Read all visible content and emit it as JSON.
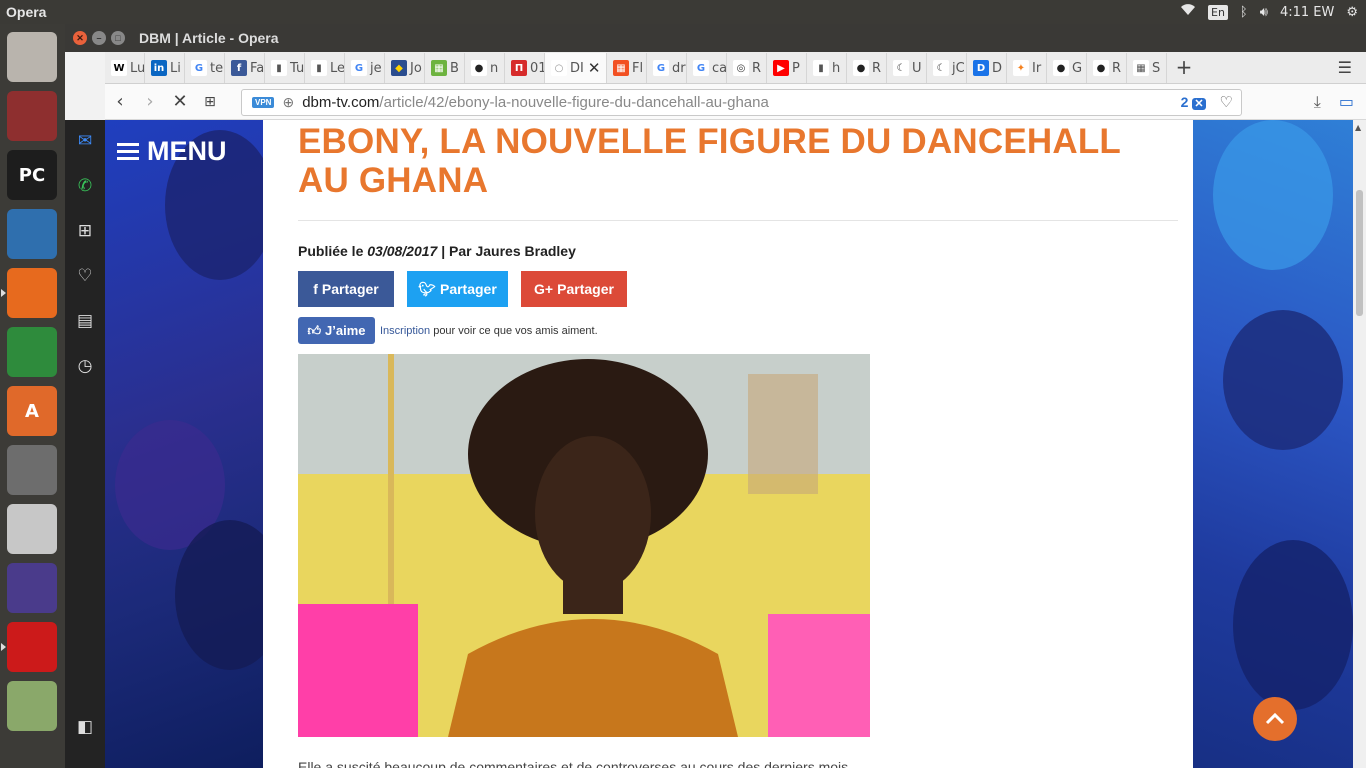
{
  "top_panel": {
    "app_name": "Opera",
    "keyboard_layout": "En",
    "clock": "4:11 EW"
  },
  "launcher": {
    "items": [
      {
        "name": "ubuntu-dash",
        "color": "#b9b4ad"
      },
      {
        "name": "files",
        "color": "#8e2f2f"
      },
      {
        "name": "pycharm",
        "color": "#1d1d1d",
        "glyph": "PC"
      },
      {
        "name": "libreoffice-writer",
        "color": "#2f6fae"
      },
      {
        "name": "firefox",
        "color": "#e76a1e"
      },
      {
        "name": "libreoffice-calc",
        "color": "#2e8b3c"
      },
      {
        "name": "software-center",
        "color": "#e0692a",
        "glyph": "A"
      },
      {
        "name": "system-settings",
        "color": "#6d6d6d"
      },
      {
        "name": "libreoffice",
        "color": "#c7c7c7"
      },
      {
        "name": "eclipse",
        "color": "#4a3b8b"
      },
      {
        "name": "opera",
        "color": "#cc1a1a"
      },
      {
        "name": "workspace-switcher",
        "color": "#8aa86a"
      }
    ]
  },
  "window": {
    "title": "DBM | Article - Opera",
    "tabs": [
      {
        "fav": "W",
        "label": "Lu",
        "color": "#ffffff",
        "fg": "#000"
      },
      {
        "fav": "in",
        "label": "Li",
        "color": "#0a66c2",
        "fg": "#fff"
      },
      {
        "fav": "G",
        "label": "te",
        "color": "#ffffff",
        "fg": "#4285f4"
      },
      {
        "fav": "f",
        "label": "Fa",
        "color": "#3b5998",
        "fg": "#fff"
      },
      {
        "fav": "▮",
        "label": "Tu",
        "color": "#ffffff",
        "fg": "#555"
      },
      {
        "fav": "▮",
        "label": "Le",
        "color": "#ffffff",
        "fg": "#555"
      },
      {
        "fav": "G",
        "label": "je",
        "color": "#ffffff",
        "fg": "#4285f4"
      },
      {
        "fav": "◆",
        "label": "Jo",
        "color": "#2a4d8f",
        "fg": "#ffd400"
      },
      {
        "fav": "▦",
        "label": "B",
        "color": "#6db33f",
        "fg": "#fff"
      },
      {
        "fav": "●",
        "label": "n",
        "color": "#ffffff",
        "fg": "#222"
      },
      {
        "fav": "П",
        "label": "01",
        "color": "#d62b2b",
        "fg": "#fff"
      },
      {
        "fav": "○",
        "label": "DI",
        "color": "#ffffff",
        "fg": "#999",
        "active": true
      },
      {
        "fav": "▦",
        "label": "Fl",
        "color": "#f25022",
        "fg": "#fff"
      },
      {
        "fav": "G",
        "label": "dr",
        "color": "#ffffff",
        "fg": "#4285f4"
      },
      {
        "fav": "G",
        "label": "ca",
        "color": "#ffffff",
        "fg": "#4285f4"
      },
      {
        "fav": "◎",
        "label": "R",
        "color": "#ffffff",
        "fg": "#333"
      },
      {
        "fav": "▶",
        "label": "P",
        "color": "#ff0000",
        "fg": "#fff"
      },
      {
        "fav": "▮",
        "label": "h",
        "color": "#ffffff",
        "fg": "#555"
      },
      {
        "fav": "●",
        "label": "R",
        "color": "#ffffff",
        "fg": "#222"
      },
      {
        "fav": "☾",
        "label": "U",
        "color": "#ffffff",
        "fg": "#333"
      },
      {
        "fav": "☾",
        "label": "jC",
        "color": "#ffffff",
        "fg": "#333"
      },
      {
        "fav": "D",
        "label": "D",
        "color": "#1a73e8",
        "fg": "#fff"
      },
      {
        "fav": "✦",
        "label": "Ir",
        "color": "#ffffff",
        "fg": "#f58220"
      },
      {
        "fav": "●",
        "label": "G",
        "color": "#ffffff",
        "fg": "#222"
      },
      {
        "fav": "●",
        "label": "R",
        "color": "#ffffff",
        "fg": "#222"
      },
      {
        "fav": "▦",
        "label": "S",
        "color": "#ffffff",
        "fg": "#555"
      }
    ],
    "address": {
      "vpn_label": "VPN",
      "host": "dbm-tv.com",
      "path": "/article/42/ebony-la-nouvelle-figure-du-dancehall-au-ghana",
      "blocked_count": "2"
    }
  },
  "page": {
    "menu_label": "MENU",
    "headline": "EBONY, LA NOUVELLE FIGURE DU DANCEHALL AU GHANA",
    "byline_prefix": "Publiée le ",
    "byline_date": "03/08/2017",
    "byline_suffix": " | Par Jaures Bradley",
    "share_buttons": {
      "facebook": "Partager",
      "twitter": "Partager",
      "google": "Partager"
    },
    "fb_like": {
      "button": "J’aime",
      "link": "Inscription",
      "text": " pour voir ce que vos amis aiment."
    },
    "body_start": "Elle a suscité beaucoup de commentaires et de controverses au cours des derniers mois"
  }
}
